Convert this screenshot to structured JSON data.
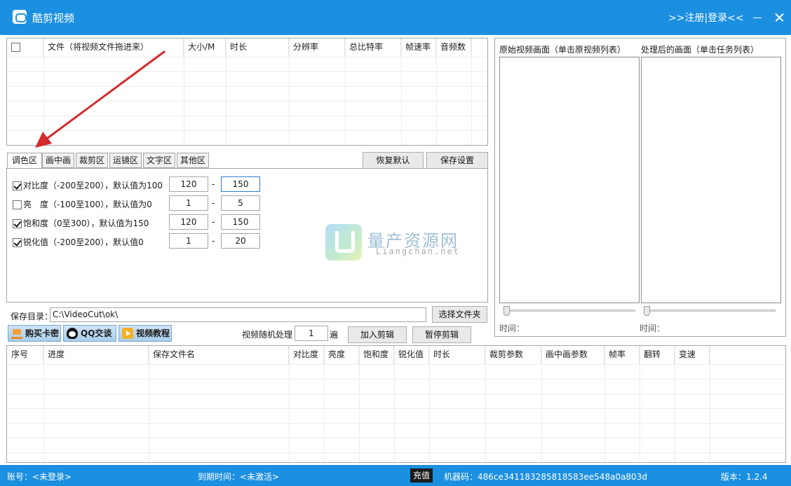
{
  "window": {
    "title": "酷剪视频",
    "login_text": ">>注册|登录<<"
  },
  "file_table": {
    "columns": [
      "文件（将视频文件拖进来）",
      "大小/M",
      "时长",
      "分辨率",
      "总比特率",
      "帧速率",
      "音频数"
    ],
    "rows": []
  },
  "tabs": [
    "调色区",
    "画中画",
    "裁剪区",
    "运镜区",
    "文字区",
    "其他区"
  ],
  "active_tab": 0,
  "tab_buttons": {
    "restore_default": "恢复默认",
    "save_settings": "保存设置"
  },
  "params": [
    {
      "label": "对比度（-200至200），默认值为100",
      "checked": true,
      "min": "120",
      "max": "150"
    },
    {
      "label": "亮　度（-100至100），默认值为0",
      "checked": false,
      "min": "1",
      "max": "5"
    },
    {
      "label": "饱和度（0至300），默认值为150",
      "checked": true,
      "min": "120",
      "max": "150"
    },
    {
      "label": "锐化值（-200至200），默认值0",
      "checked": true,
      "min": "1",
      "max": "20"
    }
  ],
  "range_sep": "-",
  "watermark": {
    "text": "量产资源网",
    "sub": "Liangchan.net"
  },
  "preview": {
    "original_label": "原始视频画面（单击原视频列表）",
    "processed_label": "处理后的画面（单击任务列表）",
    "time_label_left": "时间：",
    "time_label_right": "时间："
  },
  "save": {
    "label": "保存目录：",
    "path": "C:\\VideoCut\\ok\\",
    "choose_folder": "选择文件夹"
  },
  "actions": {
    "buy_key": "购买卡密",
    "qq_chat": "QQ交谈",
    "video_tutorial": "视频教程",
    "random_label": "视频随机处理",
    "random_value": "1",
    "random_unit": "遍",
    "add_edit": "加入剪辑",
    "pause_edit": "暂停剪辑"
  },
  "task_table": {
    "columns": [
      "序号",
      "进度",
      "保存文件名",
      "对比度",
      "亮度",
      "饱和度",
      "锐化值",
      "时长",
      "裁剪参数",
      "画中画参数",
      "帧率",
      "翻转",
      "变速"
    ],
    "rows": []
  },
  "status": {
    "account": "账号：<未登录>",
    "expire": "到期时间：<未激活>",
    "recharge": "充值",
    "machine_code": "机器码：486ce341183285818583ee548a0a803d",
    "version": "版本：1.2.4"
  },
  "colors": {
    "accent": "#1b8fe0",
    "annotation_arrow": "#d62b2b"
  }
}
